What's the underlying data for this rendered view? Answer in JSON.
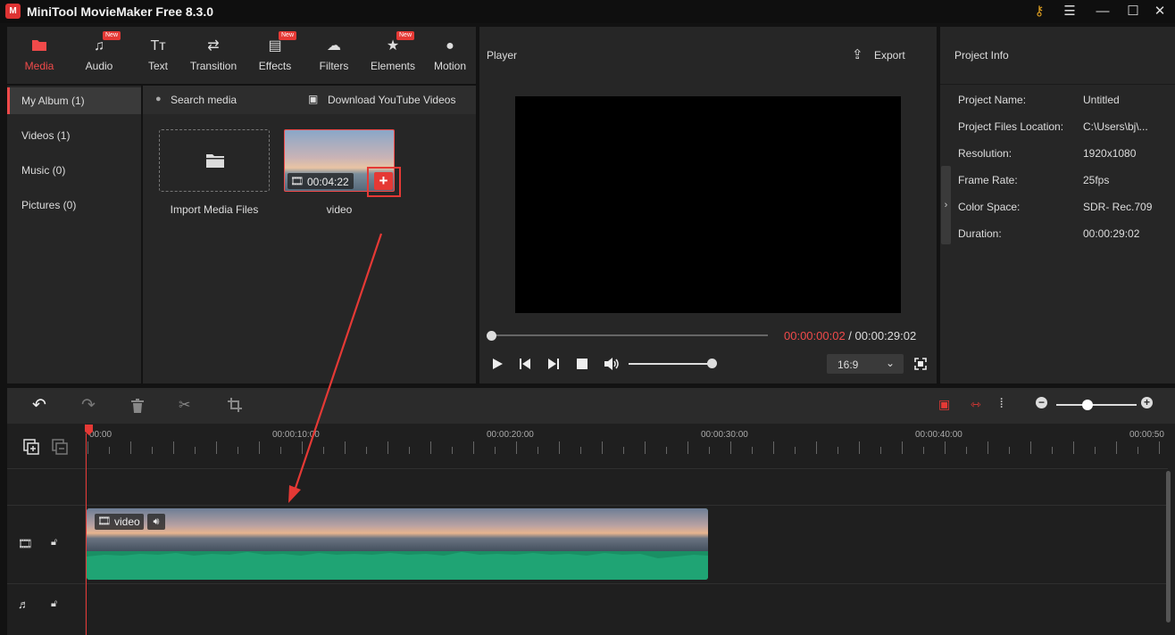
{
  "window": {
    "title": "MiniTool MovieMaker Free 8.3.0"
  },
  "toolbar": {
    "items": [
      {
        "label": "Media",
        "icon": "media-folder-icon",
        "new": false
      },
      {
        "label": "Audio",
        "icon": "music-note-icon",
        "new": true,
        "badge": "New"
      },
      {
        "label": "Text",
        "icon": "text-icon",
        "new": false
      },
      {
        "label": "Transition",
        "icon": "transition-arrows-icon",
        "new": false
      },
      {
        "label": "Effects",
        "icon": "effects-icon",
        "new": true,
        "badge": "New"
      },
      {
        "label": "Filters",
        "icon": "filters-icon",
        "new": false
      },
      {
        "label": "Elements",
        "icon": "elements-icon",
        "new": true,
        "badge": "New"
      },
      {
        "label": "Motion",
        "icon": "motion-icon",
        "new": false
      }
    ]
  },
  "sidebar": {
    "items": [
      {
        "label": "My Album (1)"
      },
      {
        "label": "Videos (1)"
      },
      {
        "label": "Music (0)"
      },
      {
        "label": "Pictures (0)"
      }
    ]
  },
  "media": {
    "search_placeholder": "Search media",
    "download_label": "Download YouTube Videos",
    "import_label": "Import Media Files",
    "video_label": "video",
    "video_duration": "00:04:22"
  },
  "player": {
    "title": "Player",
    "export_label": "Export",
    "current_time": "00:00:00:02",
    "separator": " / ",
    "total_time": "00:00:29:02",
    "aspect": "16:9"
  },
  "project_info": {
    "title": "Project Info",
    "rows": [
      {
        "key": "Project Name:",
        "value": "Untitled"
      },
      {
        "key": "Project Files Location:",
        "value": "C:\\Users\\bj\\..."
      },
      {
        "key": "Resolution:",
        "value": "1920x1080"
      },
      {
        "key": "Frame Rate:",
        "value": "25fps"
      },
      {
        "key": "Color Space:",
        "value": "SDR- Rec.709"
      },
      {
        "key": "Duration:",
        "value": "00:00:29:02"
      }
    ]
  },
  "timeline": {
    "ruler": [
      "00:00",
      "00:00:10:00",
      "00:00:20:00",
      "00:00:30:00",
      "00:00:40:00",
      "00:00:50"
    ],
    "clip_label": "video"
  },
  "colors": {
    "accent": "#f04a4a",
    "wave": "#1fa474",
    "panel": "#262626"
  }
}
